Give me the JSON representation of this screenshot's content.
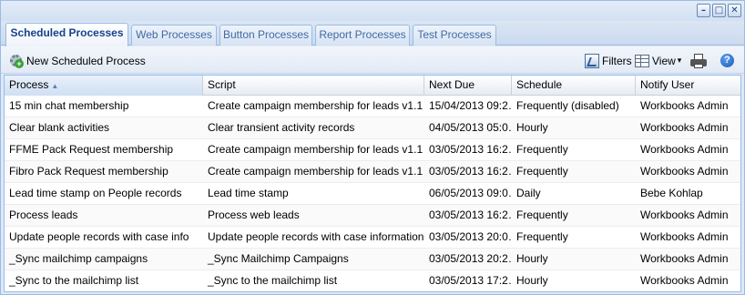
{
  "window": {
    "controls": [
      "minimize",
      "maximize",
      "close"
    ],
    "control_glyphs": [
      "–",
      "□",
      "✕"
    ]
  },
  "tabs": [
    {
      "label": "Scheduled Processes",
      "active": true
    },
    {
      "label": "Web Processes",
      "active": false
    },
    {
      "label": "Button Processes",
      "active": false
    },
    {
      "label": "Report Processes",
      "active": false
    },
    {
      "label": "Test Processes",
      "active": false
    }
  ],
  "toolbar": {
    "new_label": "New Scheduled Process",
    "filters_label": "Filters",
    "view_label": "View",
    "view_arrow": "▾",
    "help_glyph": "?"
  },
  "grid": {
    "columns": [
      "Process",
      "Script",
      "Next Due",
      "Schedule",
      "Notify User"
    ],
    "sort_arrow": "▲",
    "rows": [
      [
        "15 min chat membership",
        "Create campaign membership for leads v1.1",
        "15/04/2013 09:2…",
        "Frequently (disabled)",
        "Workbooks Admin"
      ],
      [
        "Clear blank activities",
        "Clear transient activity records",
        "04/05/2013 05:0…",
        "Hourly",
        "Workbooks Admin"
      ],
      [
        "FFME Pack Request membership",
        "Create campaign membership for leads v1.1",
        "03/05/2013 16:2…",
        "Frequently",
        "Workbooks Admin"
      ],
      [
        "Fibro Pack Request membership",
        "Create campaign membership for leads v1.1",
        "03/05/2013 16:2…",
        "Frequently",
        "Workbooks Admin"
      ],
      [
        "Lead time stamp on People records",
        "Lead time stamp",
        "06/05/2013 09:0…",
        "Daily",
        "Bebe Kohlap"
      ],
      [
        "Process leads",
        "Process web leads",
        "03/05/2013 16:2…",
        "Frequently",
        "Workbooks Admin"
      ],
      [
        "Update people records with case info",
        "Update people records with case information",
        "03/05/2013 20:0…",
        "Frequently",
        "Workbooks Admin"
      ],
      [
        "_Sync mailchimp campaigns",
        "_Sync Mailchimp Campaigns",
        "03/05/2013 20:2…",
        "Hourly",
        "Workbooks Admin"
      ],
      [
        "_Sync to the mailchimp list",
        "_Sync to the mailchimp list",
        "03/05/2013 17:2…",
        "Hourly",
        "Workbooks Admin"
      ]
    ]
  }
}
